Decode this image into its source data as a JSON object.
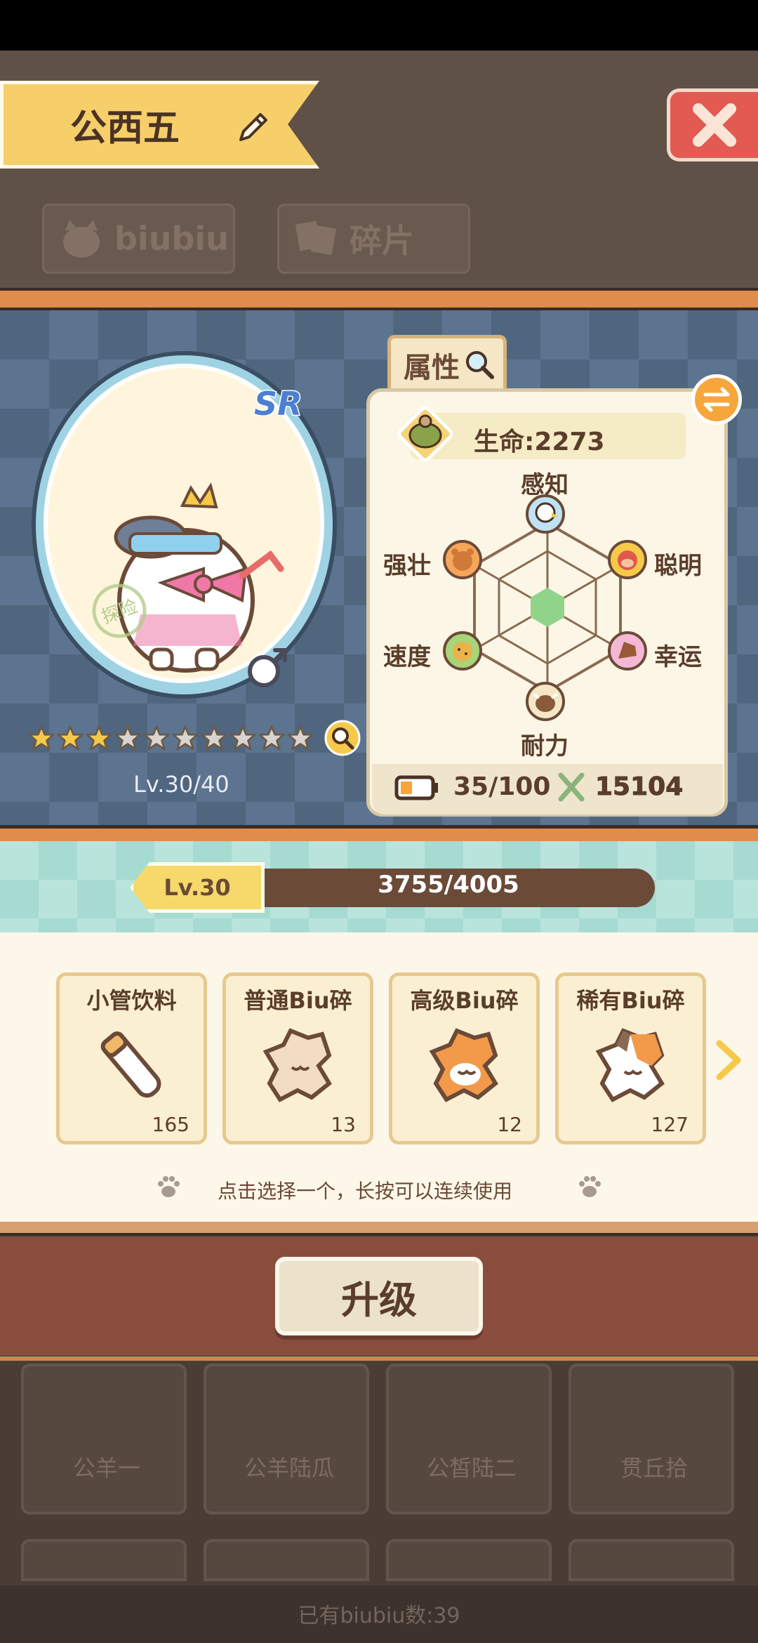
{
  "header": {
    "character_name": "公西五",
    "tabs": [
      {
        "label": "biubiu",
        "icon": "cat-icon"
      },
      {
        "label": "碎片",
        "icon": "fragments-icon"
      }
    ]
  },
  "character": {
    "rarity": "SR",
    "stamp": "探险",
    "gender": "male",
    "stars_filled": 3,
    "stars_total": 10,
    "level_text": "Lv.30/40"
  },
  "attributes": {
    "tab_label": "属性",
    "hp_text": "生命:2273",
    "stats": {
      "perception": "感知",
      "smart": "聪明",
      "luck": "幸运",
      "endurance": "耐力",
      "speed": "速度",
      "strong": "强壮"
    },
    "stamina": "35/100",
    "power": "15104"
  },
  "xp": {
    "level": "Lv.30",
    "text": "3755/4005",
    "progress": 0.9375
  },
  "items": [
    {
      "name": "小管饮料",
      "count": "165",
      "icon": "drink-tube-icon"
    },
    {
      "name": "普通Biu碎",
      "count": "13",
      "icon": "common-fragment-icon"
    },
    {
      "name": "高级Biu碎",
      "count": "12",
      "icon": "advanced-fragment-icon"
    },
    {
      "name": "稀有Biu碎",
      "count": "127",
      "icon": "rare-fragment-icon"
    }
  ],
  "hint": "点击选择一个，长按可以连续使用",
  "upgrade_label": "升级",
  "roster": [
    {
      "name": "公羊一"
    },
    {
      "name": "公羊陆瓜"
    },
    {
      "name": "公皙陆二"
    },
    {
      "name": "贯丘拾"
    }
  ],
  "owned_count": "已有biubiu数:39",
  "colors": {
    "banner": "#f7cf6a",
    "close": "#e25a52",
    "board": "#4f667e",
    "xp_band": "#b9e4dc",
    "upgrade_band": "#8a4d3d"
  }
}
